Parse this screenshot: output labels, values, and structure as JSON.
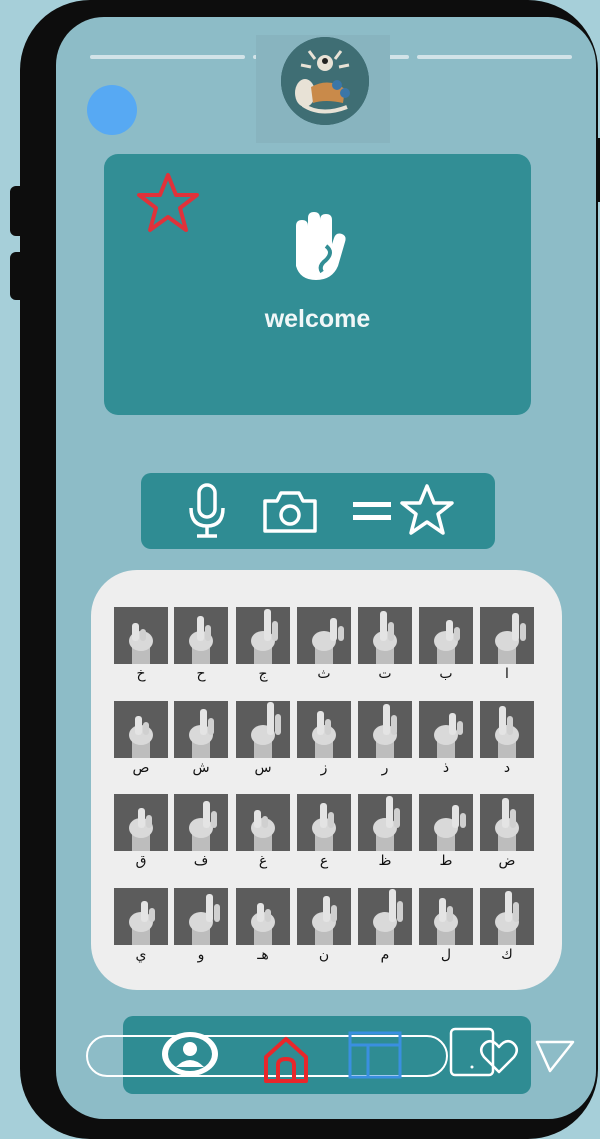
{
  "story": {
    "segments": 3
  },
  "welcome": {
    "title": "welcome"
  },
  "toolbar": {
    "icons": [
      "microphone-icon",
      "camera-icon",
      "equals-icon",
      "star-icon"
    ]
  },
  "alphabet": {
    "rows": [
      [
        "خ",
        "ح",
        "ج",
        "ث",
        "ت",
        "ب",
        "ا"
      ],
      [
        "ص",
        "ش",
        "س",
        "ز",
        "ر",
        "ذ",
        "د"
      ],
      [
        "ق",
        "ف",
        "غ",
        "ع",
        "ظ",
        "ط",
        "ض"
      ],
      [
        "ي",
        "و",
        "هـ",
        "ن",
        "م",
        "ل",
        "ك"
      ]
    ]
  },
  "bottom_nav": {
    "icons": [
      "person-icon",
      "home-icon",
      "layout-icon",
      "phone-outline-icon",
      "heart-icon",
      "send-icon"
    ]
  },
  "colors": {
    "background": "#a6cfd9",
    "screen": "#8dbcc7",
    "teal": "#328e95",
    "star_red": "#e0323a",
    "profile_blue": "#57a9f3",
    "home_red": "#e8272b",
    "layout_blue": "#3a8fe0"
  }
}
